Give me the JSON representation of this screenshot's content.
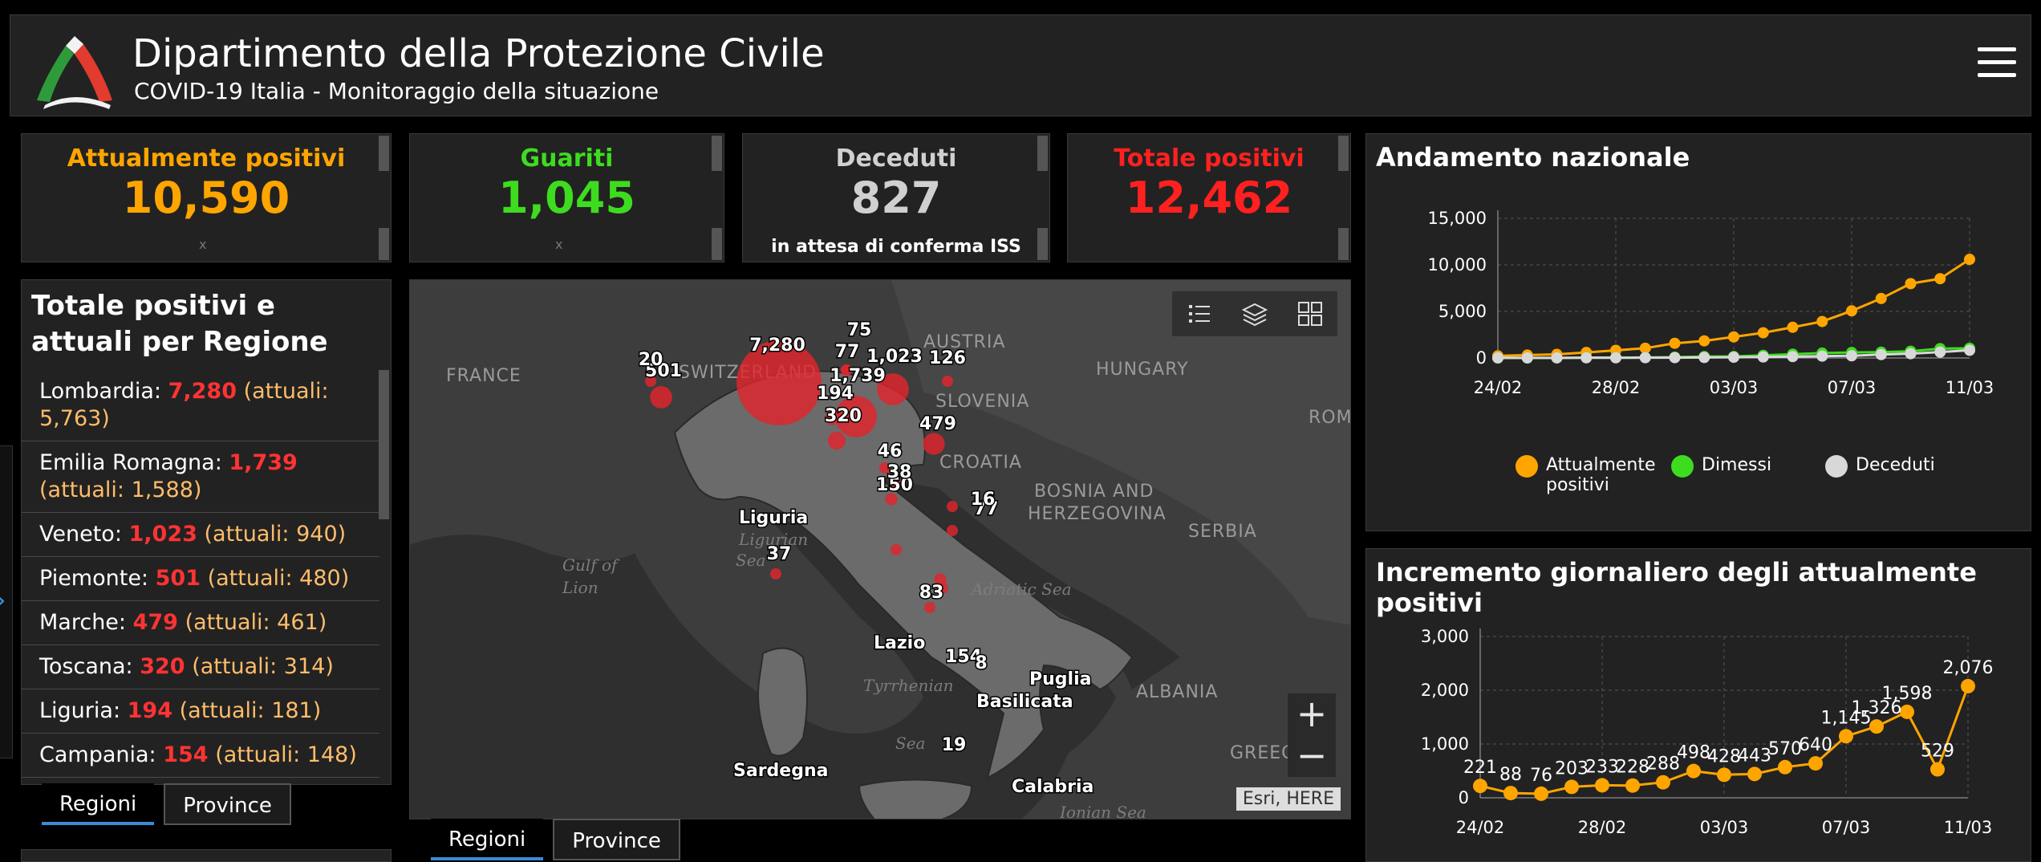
{
  "header": {
    "title": "Dipartimento della Protezione Civile",
    "subtitle": "COVID-19 Italia - Monitoraggio della situazione"
  },
  "cards": {
    "attivi": {
      "label": "Attualmente positivi",
      "value": "10,590",
      "color": "#ffa500",
      "mini": "x"
    },
    "guariti": {
      "label": "Guariti",
      "value": "1,045",
      "color": "#3ddc1f",
      "mini": "x"
    },
    "deceduti": {
      "label": "Deceduti",
      "value": "827",
      "color": "#d0d0d0",
      "note": "in attesa di conferma ISS"
    },
    "totale": {
      "label": "Totale positivi",
      "value": "12,462",
      "color": "#ff2020"
    }
  },
  "regions_panel": {
    "title": "Totale positivi e attuali per Regione",
    "rows": [
      {
        "name": "Lombardia:",
        "pos": "7,280",
        "act": "(attuali: 5,763)"
      },
      {
        "name": "Emilia Romagna:",
        "pos": "1,739",
        "act": "(attuali: 1,588)"
      },
      {
        "name": "Veneto:",
        "pos": "1,023",
        "act": "(attuali: 940)"
      },
      {
        "name": "Piemonte:",
        "pos": "501",
        "act": "(attuali: 480)"
      },
      {
        "name": "Marche:",
        "pos": "479",
        "act": "(attuali: 461)"
      },
      {
        "name": "Toscana:",
        "pos": "320",
        "act": "(attuali: 314)"
      },
      {
        "name": "Liguria:",
        "pos": "194",
        "act": "(attuali: 181)"
      },
      {
        "name": "Campania:",
        "pos": "154",
        "act": "(attuali: 148)"
      }
    ],
    "tabs": [
      "Regioni",
      "Province"
    ]
  },
  "map": {
    "tabs": [
      "Regioni",
      "Province"
    ],
    "attribution": "Esri, HERE",
    "zoom_in": "+",
    "zoom_out": "−",
    "countries": [
      "FRANCE",
      "SWITZERLAND",
      "AUSTRIA",
      "HUNGARY",
      "SLOVENIA",
      "CROATIA",
      "BOSNIA AND",
      "HERZEGOVINA",
      "SERBIA",
      "ALBANIA",
      "ROM",
      "GREEC"
    ],
    "seas": [
      "Ligurian",
      "Sea",
      "Gulf of",
      "Lion",
      "Adriatic Sea",
      "Tyrrhenian",
      "Sea",
      "Ionian Sea"
    ],
    "places": [
      "Liguria",
      "Lazio",
      "Puglia",
      "Basilicata",
      "Sardegna",
      "Calabria"
    ],
    "markers": [
      {
        "label": "7,280",
        "value": 7280
      },
      {
        "label": "1,739",
        "value": 1739
      },
      {
        "label": "1,023",
        "value": 1023
      },
      {
        "label": "501",
        "value": 501
      },
      {
        "label": "479",
        "value": 479
      },
      {
        "label": "320",
        "value": 320
      },
      {
        "label": "194",
        "value": 194
      },
      {
        "label": "154",
        "value": 154
      },
      {
        "label": "150",
        "value": 150
      },
      {
        "label": "126",
        "value": 126
      },
      {
        "label": "83",
        "value": 83
      },
      {
        "label": "77",
        "value": 77
      },
      {
        "label": "77",
        "value": 77
      },
      {
        "label": "75",
        "value": 75
      },
      {
        "label": "46",
        "value": 46
      },
      {
        "label": "38",
        "value": 38
      },
      {
        "label": "37",
        "value": 37
      },
      {
        "label": "20",
        "value": 20
      },
      {
        "label": "19",
        "value": 19
      },
      {
        "label": "16",
        "value": 16
      },
      {
        "label": "8",
        "value": 8
      }
    ]
  },
  "colors": {
    "orange": "#ffa500",
    "green": "#3ddc1f",
    "grey": "#d8d8d8"
  },
  "chart_data": [
    {
      "type": "line",
      "title": "Andamento nazionale",
      "x": [
        "24/02",
        "25/02",
        "26/02",
        "27/02",
        "28/02",
        "29/02",
        "01/03",
        "02/03",
        "03/03",
        "04/03",
        "05/03",
        "06/03",
        "07/03",
        "08/03",
        "09/03",
        "10/03",
        "11/03"
      ],
      "tick_labels": [
        "24/02",
        "28/02",
        "03/03",
        "07/03",
        "11/03"
      ],
      "yticks": [
        "0",
        "5,000",
        "10,000",
        "15,000"
      ],
      "ylim": [
        0,
        15000
      ],
      "series": [
        {
          "name": "Attualmente positivi",
          "values": [
            221,
            311,
            385,
            588,
            821,
            1049,
            1577,
            1835,
            2263,
            2706,
            3296,
            3916,
            5061,
            6387,
            7985,
            8514,
            10590
          ]
        },
        {
          "name": "Dimessi",
          "values": [
            1,
            1,
            3,
            45,
            46,
            50,
            83,
            149,
            160,
            276,
            414,
            523,
            589,
            622,
            724,
            1004,
            1045
          ]
        },
        {
          "name": "Deceduti",
          "values": [
            7,
            10,
            12,
            17,
            21,
            29,
            34,
            52,
            79,
            107,
            148,
            197,
            233,
            366,
            463,
            631,
            827
          ]
        }
      ],
      "legend": [
        "Attualmente positivi",
        "Dimessi",
        "Deceduti"
      ]
    },
    {
      "type": "line",
      "title": "Incremento giornaliero degli attualmente positivi",
      "x": [
        "24/02",
        "25/02",
        "26/02",
        "27/02",
        "28/02",
        "29/02",
        "01/03",
        "02/03",
        "03/03",
        "04/03",
        "05/03",
        "06/03",
        "07/03",
        "08/03",
        "09/03",
        "10/03",
        "11/03"
      ],
      "tick_labels": [
        "24/02",
        "28/02",
        "03/03",
        "07/03",
        "11/03"
      ],
      "yticks": [
        "0",
        "1,000",
        "2,000",
        "3,000"
      ],
      "ylim": [
        0,
        3000
      ],
      "series": [
        {
          "name": "",
          "values": [
            221,
            88,
            76,
            203,
            233,
            228,
            288,
            498,
            428,
            443,
            570,
            640,
            1145,
            1326,
            1598,
            529,
            2076
          ]
        }
      ],
      "data_labels": [
        "221",
        "88",
        "76",
        "203",
        "233",
        "228",
        "288",
        "498",
        "428",
        "443",
        "570",
        "640",
        "1,145",
        "1,326",
        "1,598",
        "529",
        "2,076"
      ]
    }
  ]
}
